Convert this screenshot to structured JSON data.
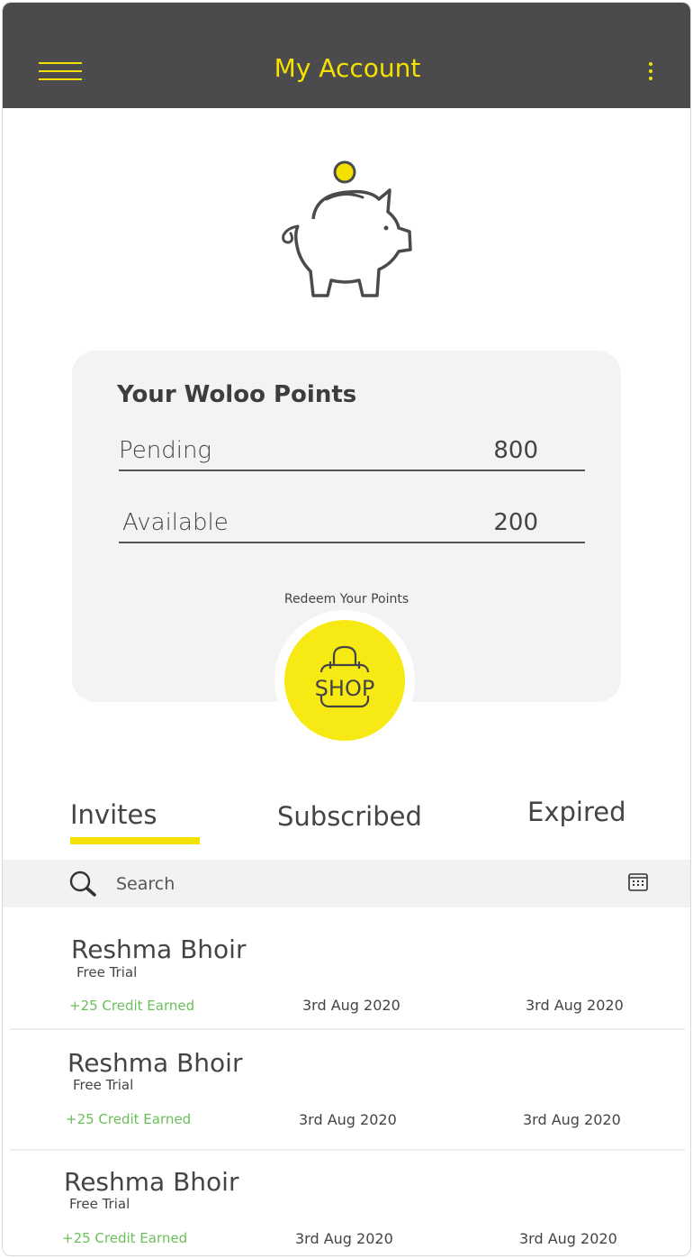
{
  "header": {
    "title": "My Account"
  },
  "points": {
    "title": "Your Woloo Points",
    "rows": [
      {
        "label": "Pending",
        "value": "800"
      },
      {
        "label": "Available",
        "value": "200"
      }
    ],
    "redeem_label": "Redeem Your Points",
    "shop_label": "SHOP"
  },
  "tabs": [
    {
      "label": "Invites",
      "active": true
    },
    {
      "label": "Subscribed",
      "active": false
    },
    {
      "label": "Expired",
      "active": false
    }
  ],
  "search": {
    "placeholder": "Search",
    "value": ""
  },
  "list": [
    {
      "name": "Reshma Bhoir",
      "plan": "Free Trial",
      "credit": "+25 Credit Earned",
      "date1": "3rd Aug 2020",
      "date2": "3rd Aug 2020"
    },
    {
      "name": "Reshma Bhoir",
      "plan": "Free Trial",
      "credit": "+25 Credit Earned",
      "date1": "3rd Aug 2020",
      "date2": "3rd Aug 2020"
    },
    {
      "name": "Reshma Bhoir",
      "plan": "Free Trial",
      "credit": "+25 Credit Earned",
      "date1": "3rd Aug 2020",
      "date2": "3rd Aug 2020"
    }
  ],
  "colors": {
    "header_bg": "#4b4b4d",
    "accent": "#f5e100",
    "credit_green": "#6bbf5a"
  },
  "icons": [
    "menu-icon",
    "more-vertical-icon",
    "piggy-bank-icon",
    "shopping-bag-icon",
    "search-icon",
    "calendar-icon"
  ]
}
